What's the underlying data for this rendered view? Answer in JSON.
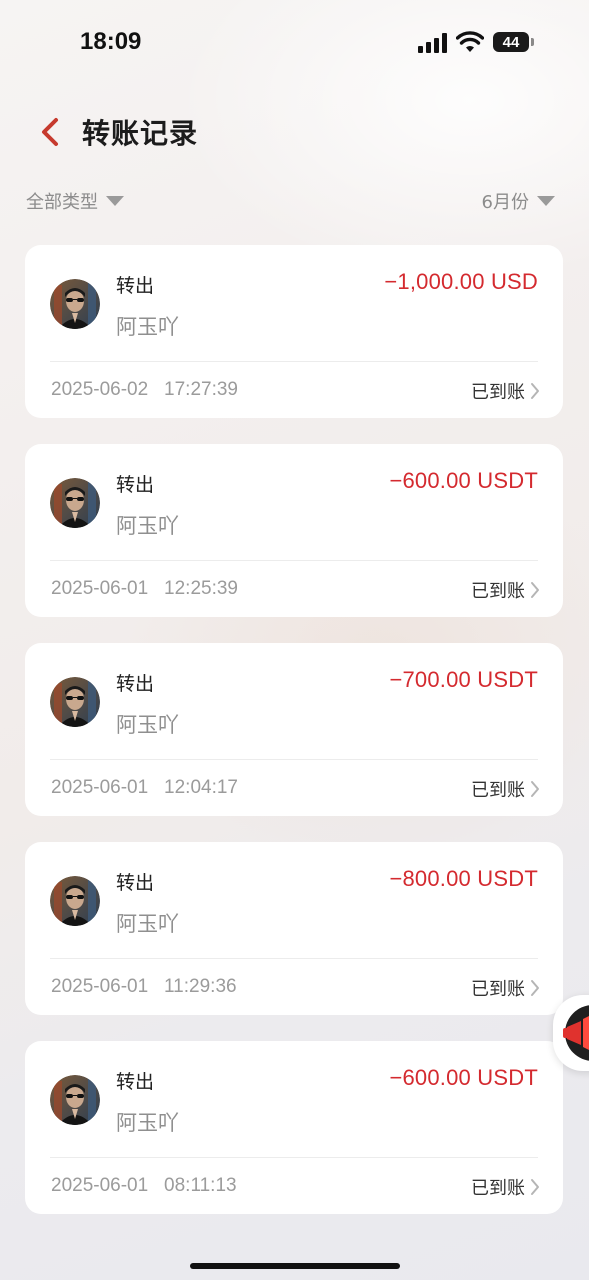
{
  "status_bar": {
    "time": "18:09",
    "battery": "44"
  },
  "header": {
    "title": "转账记录"
  },
  "filters": {
    "type_label": "全部类型",
    "month_label": "6月份"
  },
  "transactions": [
    {
      "type": "转出",
      "name": "阿玉吖",
      "amount": "−1,000.00 USD",
      "time": "2025-06-02   17:27:39",
      "status": "已到账"
    },
    {
      "type": "转出",
      "name": "阿玉吖",
      "amount": "−600.00 USDT",
      "time": "2025-06-01   12:25:39",
      "status": "已到账"
    },
    {
      "type": "转出",
      "name": "阿玉吖",
      "amount": "−700.00 USDT",
      "time": "2025-06-01   12:04:17",
      "status": "已到账"
    },
    {
      "type": "转出",
      "name": "阿玉吖",
      "amount": "−800.00 USDT",
      "time": "2025-06-01   11:29:36",
      "status": "已到账"
    },
    {
      "type": "转出",
      "name": "阿玉吖",
      "amount": "−600.00 USDT",
      "time": "2025-06-01   08:11:13",
      "status": "已到账"
    }
  ],
  "colors": {
    "amount_red": "#d42a2f",
    "back_arrow": "#c63a2e"
  },
  "icons": {
    "back": "chevron-left-icon",
    "dropdown": "triangle-down-icon",
    "row_arrow": "chevron-right-icon",
    "float": "megaphone-icon"
  }
}
